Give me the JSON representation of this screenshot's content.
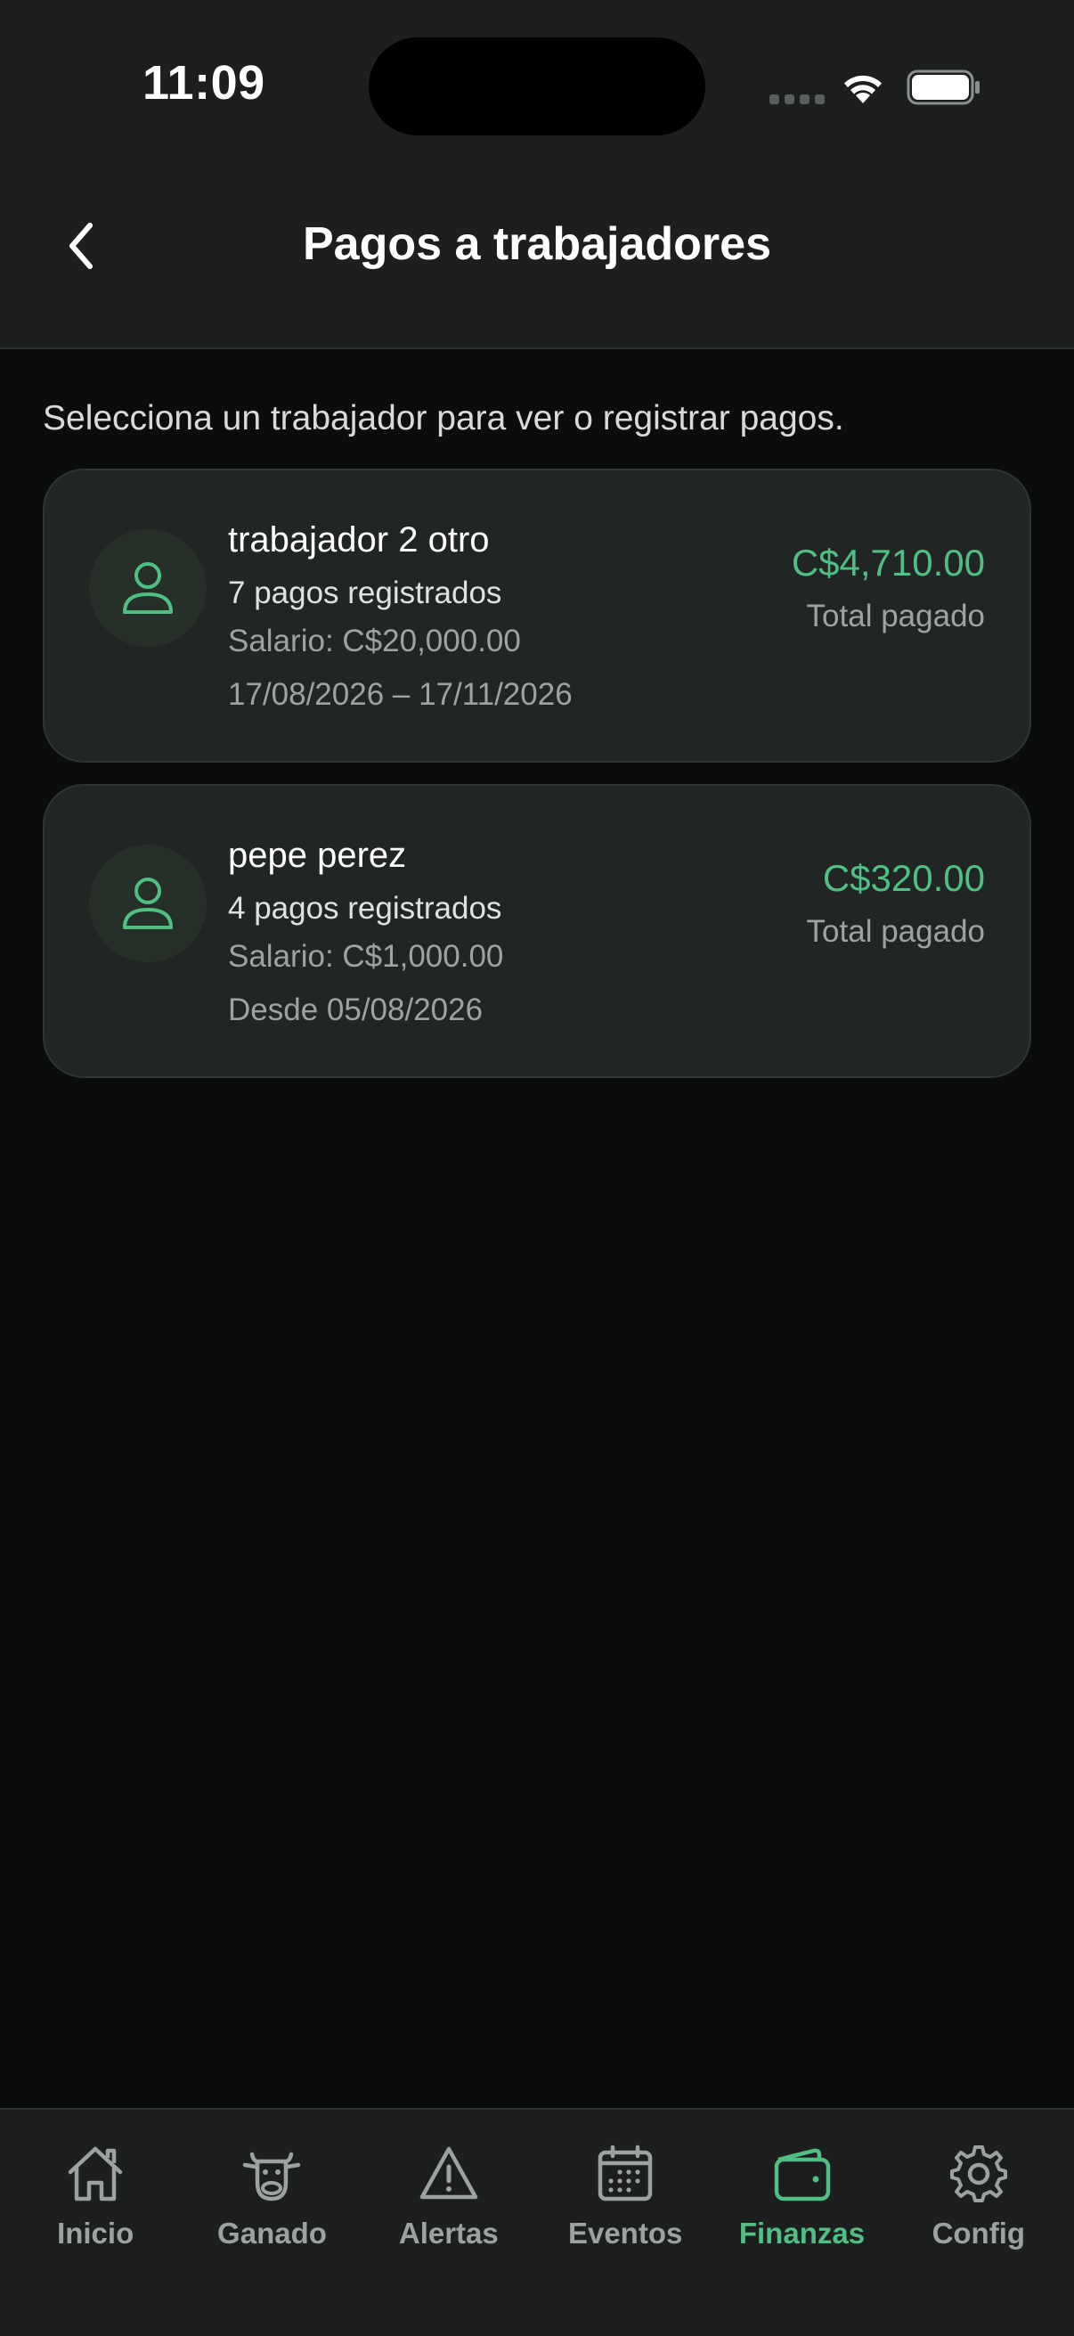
{
  "status_bar": {
    "time": "11:09"
  },
  "header": {
    "title": "Pagos a trabajadores",
    "back_icon": "chevron-left-icon"
  },
  "subtitle": "Selecciona un trabajador para ver o registrar pagos.",
  "workers": [
    {
      "name": "trabajador 2 otro",
      "payments": "7 pagos registrados",
      "salary": "Salario: C$20,000.00",
      "period": "17/08/2026 – 17/11/2026",
      "total": "C$4,710.00",
      "total_label": "Total pagado"
    },
    {
      "name": "pepe perez",
      "payments": "4 pagos registrados",
      "salary": "Salario: C$1,000.00",
      "period": "Desde 05/08/2026",
      "total": "C$320.00",
      "total_label": "Total pagado"
    }
  ],
  "tabs": [
    {
      "label": "Inicio",
      "icon": "home-icon",
      "active": false
    },
    {
      "label": "Ganado",
      "icon": "cow-icon",
      "active": false
    },
    {
      "label": "Alertas",
      "icon": "warning-icon",
      "active": false
    },
    {
      "label": "Eventos",
      "icon": "calendar-icon",
      "active": false
    },
    {
      "label": "Finanzas",
      "icon": "wallet-icon",
      "active": true
    },
    {
      "label": "Config",
      "icon": "gear-icon",
      "active": false
    }
  ],
  "colors": {
    "accent": "#4fbf83",
    "card": "#212625",
    "background": "#0b0d0c",
    "header": "#1c1f1e"
  }
}
